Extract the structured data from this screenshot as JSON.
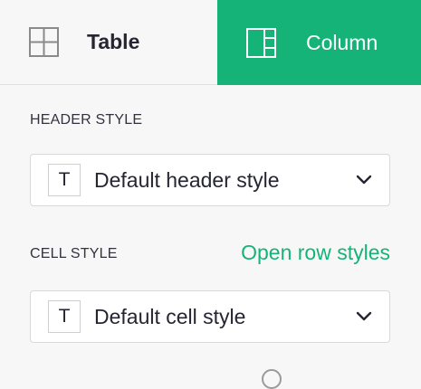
{
  "tabs": {
    "table": {
      "label": "Table",
      "icon": "table-grid-icon"
    },
    "column": {
      "label": "Column",
      "icon": "column-layout-icon",
      "active": true
    }
  },
  "header_style": {
    "label": "HEADER STYLE",
    "select_icon_letter": "T",
    "value": "Default header style"
  },
  "cell_style": {
    "label": "CELL STYLE",
    "link": "Open row styles",
    "select_icon_letter": "T",
    "value": "Default cell style"
  },
  "colors": {
    "accent": "#16b378",
    "background": "#f7f7f7",
    "text": "#262633"
  }
}
